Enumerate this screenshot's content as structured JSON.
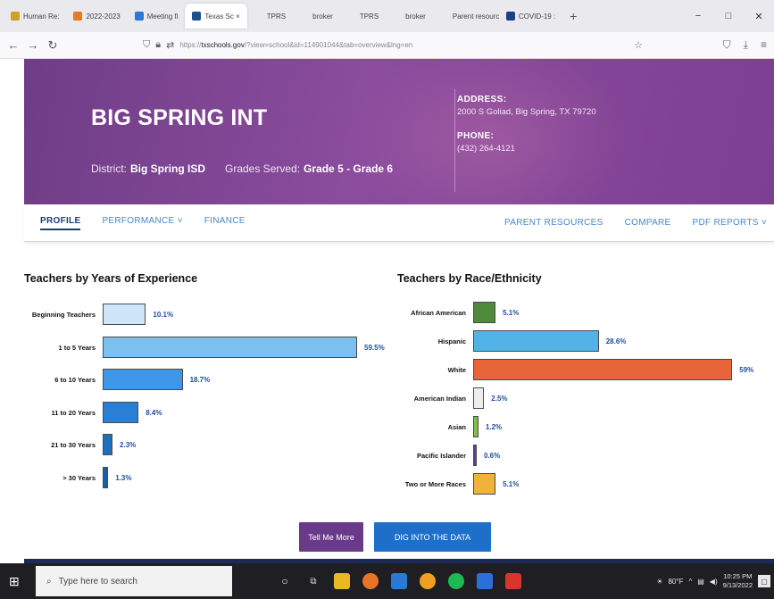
{
  "browser": {
    "tabs": [
      {
        "label": "Human Re:",
        "color": "#c9a227",
        "active": false
      },
      {
        "label": "2022-2023",
        "color": "#e07b2a",
        "active": false
      },
      {
        "label": "Meeting fi",
        "color": "#2b79d6",
        "active": false
      },
      {
        "label": "Texas Sc ×",
        "color": "#1e4f8f",
        "active": true
      },
      {
        "label": "TPRS",
        "color": "#e9e9ee",
        "active": false
      },
      {
        "label": "broker",
        "color": "#e9e9ee",
        "active": false
      },
      {
        "label": "TPRS",
        "color": "#e9e9ee",
        "active": false
      },
      {
        "label": "broker",
        "color": "#e9e9ee",
        "active": false
      },
      {
        "label": "Parent resourc",
        "color": "#e9e9ee",
        "active": false
      },
      {
        "label": "COVID-19 :",
        "color": "#1d3f8f",
        "active": false
      }
    ],
    "url_prefix": "https://",
    "url_host": "txschools.gov",
    "url_rest": "/?view=school&id=114901044&tab=overview&lng=en",
    "window_controls": {
      "minimize": "−",
      "maximize": "□",
      "close": "✕"
    }
  },
  "header": {
    "school_name": "BIG SPRING INT",
    "district_label": "District:",
    "district": "Big Spring ISD",
    "grades_label": "Grades Served:",
    "grades": "Grade 5 - Grade 6",
    "address_label": "ADDRESS:",
    "address": "2000 S Goliad, Big Spring, TX 79720",
    "phone_label": "PHONE:",
    "phone": "(432) 264-4121",
    "bg_color": "#7b4391"
  },
  "nav": {
    "profile": "PROFILE",
    "performance": "PERFORMANCE ˅",
    "finance": "FINANCE",
    "parent_resources": "PARENT RESOURCES",
    "compare": "COMPARE",
    "pdf_reports": "PDF REPORTS ˅"
  },
  "experience_chart": {
    "title": "Teachers by Years of Experience",
    "rows": [
      {
        "label": "Beginning Teachers",
        "value_text": "10.1%",
        "value": 10.1,
        "color": "#cfe6f8"
      },
      {
        "label": "1 to 5 Years",
        "value_text": "59.5%",
        "value": 59.5,
        "color": "#7cc0ef"
      },
      {
        "label": "6 to 10 Years",
        "value_text": "18.7%",
        "value": 18.7,
        "color": "#3f95e8"
      },
      {
        "label": "11 to 20 Years",
        "value_text": "8.4%",
        "value": 8.4,
        "color": "#2a7fd4"
      },
      {
        "label": "21 to 30 Years",
        "value_text": "2.3%",
        "value": 2.3,
        "color": "#1f6fc0"
      },
      {
        "label": "> 30 Years",
        "value_text": "1.3%",
        "value": 1.3,
        "color": "#1a5ea8"
      }
    ]
  },
  "race_chart": {
    "title": "Teachers by Race/Ethnicity",
    "rows": [
      {
        "label": "African American",
        "value_text": "5.1%",
        "value": 5.1,
        "color": "#4e8a3a"
      },
      {
        "label": "Hispanic",
        "value_text": "28.6%",
        "value": 28.6,
        "color": "#52b3e6"
      },
      {
        "label": "White",
        "value_text": "59%",
        "value": 59,
        "color": "#e8643a"
      },
      {
        "label": "American Indian",
        "value_text": "2.5%",
        "value": 2.5,
        "color": "#eeeeee"
      },
      {
        "label": "Asian",
        "value_text": "1.2%",
        "value": 1.2,
        "color": "#7cc04a"
      },
      {
        "label": "Pacific Islander",
        "value_text": "0.6%",
        "value": 0.6,
        "color": "#6a3a8a"
      },
      {
        "label": "Two or More Races",
        "value_text": "5.1%",
        "value": 5.1,
        "color": "#f1b23a"
      }
    ]
  },
  "buttons": {
    "tell_me_more": "Tell Me More",
    "dig_into_data": "DIG INTO THE DATA"
  },
  "taskbar": {
    "search_placeholder": "Type here to search",
    "temperature": "80°F",
    "time": "10:25 PM",
    "date": "9/13/2022"
  }
}
